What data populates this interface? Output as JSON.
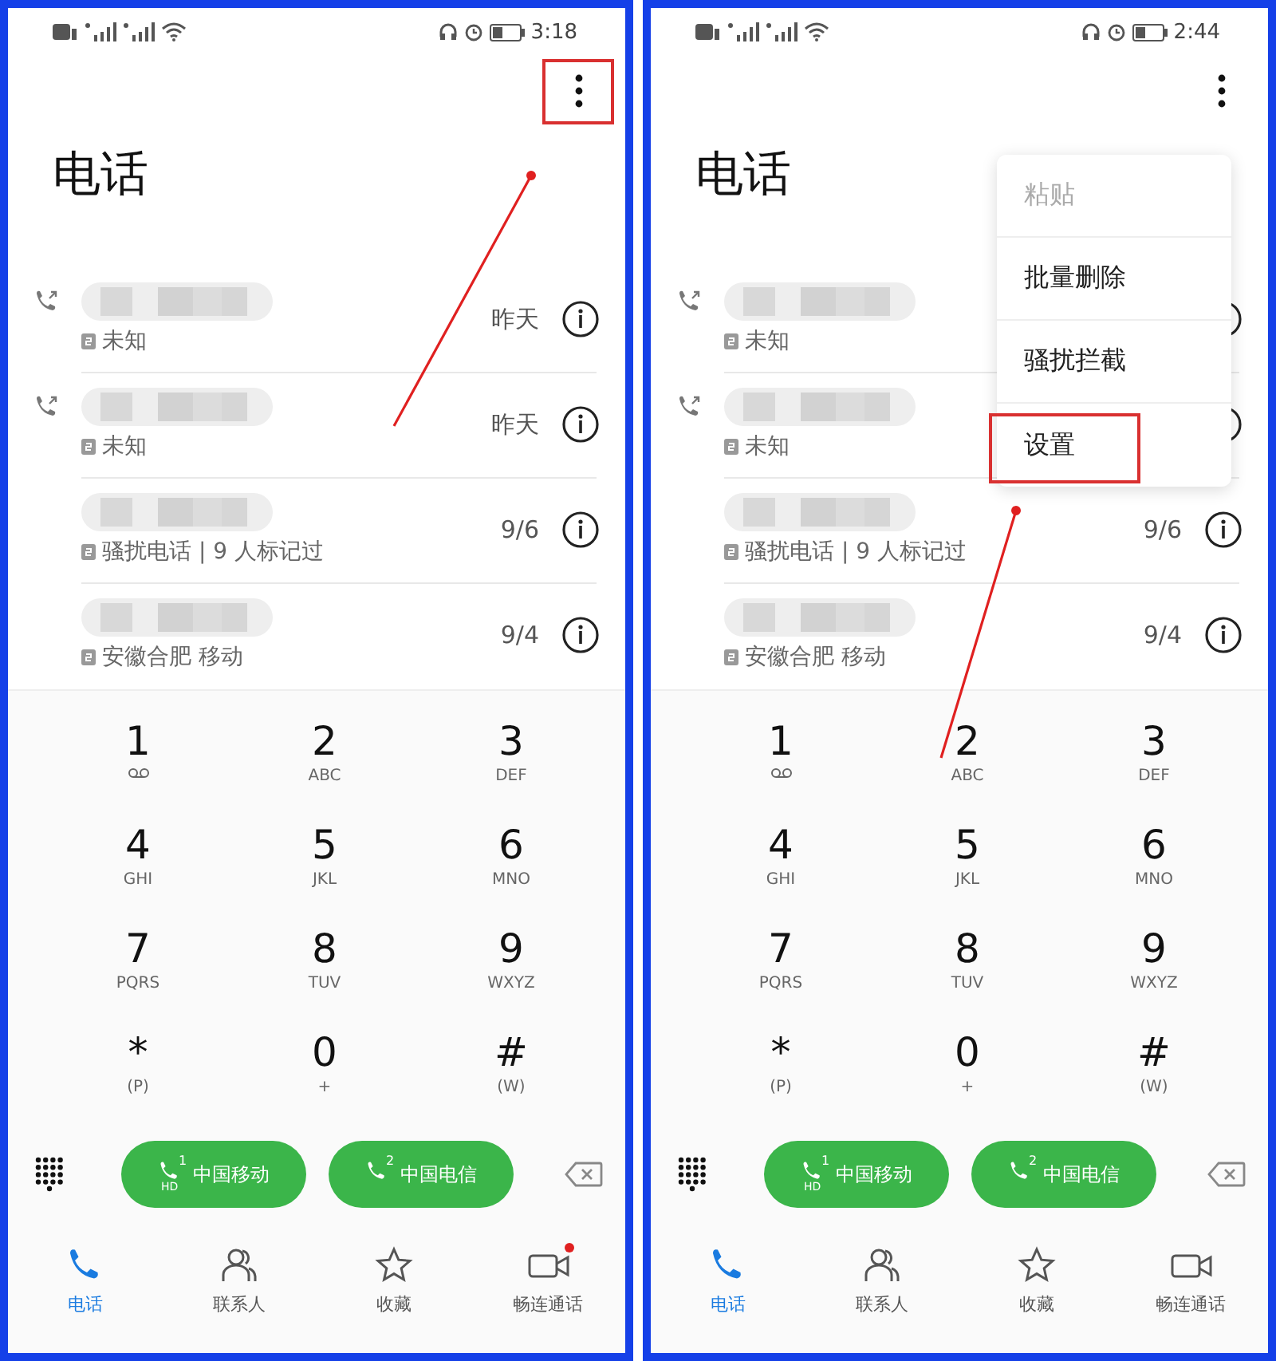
{
  "screens": [
    {
      "status_bar": {
        "time": "3:18"
      },
      "more_button": {
        "highlighted": true
      },
      "title": "电话",
      "arrow": true,
      "calls": [
        {
          "outgoing": true,
          "detail": "未知",
          "date": "昨天"
        },
        {
          "outgoing": true,
          "detail": "未知",
          "date": "昨天"
        },
        {
          "outgoing": false,
          "detail": "骚扰电话 | 9 人标记过",
          "date": "9/6"
        },
        {
          "outgoing": false,
          "detail": "安徽合肥 移动",
          "date": "9/4"
        }
      ],
      "keys": [
        {
          "kind": "voicemail",
          "digit": "1"
        },
        {
          "kind": "letters",
          "digit": "2",
          "letters": "ABC"
        },
        {
          "kind": "letters",
          "digit": "3",
          "letters": "DEF"
        },
        {
          "kind": "letters",
          "digit": "4",
          "letters": "GHI"
        },
        {
          "kind": "letters",
          "digit": "5",
          "letters": "JKL"
        },
        {
          "kind": "letters",
          "digit": "6",
          "letters": "MNO"
        },
        {
          "kind": "letters",
          "digit": "7",
          "letters": "PQRS"
        },
        {
          "kind": "letters",
          "digit": "8",
          "letters": "TUV"
        },
        {
          "kind": "letters",
          "digit": "9",
          "letters": "WXYZ"
        },
        {
          "kind": "letters",
          "digit": "*",
          "letters": "(P)"
        },
        {
          "kind": "letters",
          "digit": "0",
          "letters": "+"
        },
        {
          "kind": "letters",
          "digit": "#",
          "letters": "(W)"
        }
      ],
      "sim_buttons": [
        {
          "sim": "1",
          "hd": "HD",
          "label": "中国移动"
        },
        {
          "sim": "2",
          "label": "中国电信"
        }
      ],
      "tabs": [
        {
          "kind": "phone",
          "label": "电话",
          "selected": true,
          "badge": false
        },
        {
          "kind": "contacts",
          "label": "联系人",
          "selected": false,
          "badge": false
        },
        {
          "kind": "star",
          "label": "收藏",
          "selected": false,
          "badge": false
        },
        {
          "kind": "video",
          "label": "畅连通话",
          "selected": false,
          "badge": true
        }
      ]
    },
    {
      "status_bar": {
        "time": "2:44"
      },
      "more_button": {
        "highlighted": false
      },
      "title": "电话",
      "arrow": true,
      "calls": [
        {
          "outgoing": true,
          "detail": "未知"
        },
        {
          "outgoing": true,
          "detail": "未知"
        },
        {
          "outgoing": false,
          "detail": "骚扰电话 | 9 人标记过",
          "date": "9/6"
        },
        {
          "outgoing": false,
          "detail": "安徽合肥 移动",
          "date": "9/4"
        }
      ],
      "menu": {
        "items": [
          {
            "label": "粘贴",
            "disabled": true,
            "highlighted": false
          },
          {
            "label": "批量删除",
            "disabled": false,
            "highlighted": false
          },
          {
            "label": "骚扰拦截",
            "disabled": false,
            "highlighted": false
          },
          {
            "label": "设置",
            "disabled": false,
            "highlighted": true
          }
        ]
      },
      "keys": [
        {
          "kind": "voicemail",
          "digit": "1"
        },
        {
          "kind": "letters",
          "digit": "2",
          "letters": "ABC"
        },
        {
          "kind": "letters",
          "digit": "3",
          "letters": "DEF"
        },
        {
          "kind": "letters",
          "digit": "4",
          "letters": "GHI"
        },
        {
          "kind": "letters",
          "digit": "5",
          "letters": "JKL"
        },
        {
          "kind": "letters",
          "digit": "6",
          "letters": "MNO"
        },
        {
          "kind": "letters",
          "digit": "7",
          "letters": "PQRS"
        },
        {
          "kind": "letters",
          "digit": "8",
          "letters": "TUV"
        },
        {
          "kind": "letters",
          "digit": "9",
          "letters": "WXYZ"
        },
        {
          "kind": "letters",
          "digit": "*",
          "letters": "(P)"
        },
        {
          "kind": "letters",
          "digit": "0",
          "letters": "+"
        },
        {
          "kind": "letters",
          "digit": "#",
          "letters": "(W)"
        }
      ],
      "sim_buttons": [
        {
          "sim": "1",
          "hd": "HD",
          "label": "中国移动"
        },
        {
          "sim": "2",
          "label": "中国电信"
        }
      ],
      "tabs": [
        {
          "kind": "phone",
          "label": "电话",
          "selected": true,
          "badge": false
        },
        {
          "kind": "contacts",
          "label": "联系人",
          "selected": false,
          "badge": false
        },
        {
          "kind": "star",
          "label": "收藏",
          "selected": false,
          "badge": false
        },
        {
          "kind": "video",
          "label": "畅连通话",
          "selected": false,
          "badge": false
        }
      ]
    }
  ]
}
